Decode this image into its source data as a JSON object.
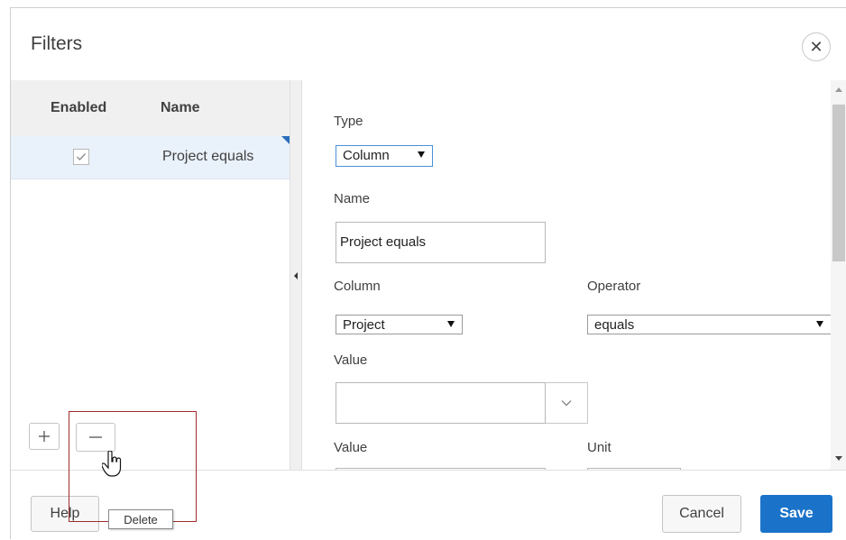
{
  "dialog": {
    "title": "Filters",
    "close_icon": "close-icon"
  },
  "list": {
    "headers": {
      "enabled": "Enabled",
      "name": "Name"
    },
    "rows": [
      {
        "enabled": true,
        "name": "Project equals"
      }
    ],
    "add_icon": "plus-icon",
    "remove_icon": "minus-icon"
  },
  "form": {
    "type_label": "Type",
    "type_value": "Column",
    "name_label": "Name",
    "name_value": "Project equals",
    "column_label": "Column",
    "column_value": "Project",
    "operator_label": "Operator",
    "operator_value": "equals",
    "value_label": "Value",
    "value_value": "",
    "value2_label": "Value",
    "unit_label": "Unit"
  },
  "footer": {
    "help_label": "Help",
    "cancel_label": "Cancel",
    "save_label": "Save"
  },
  "tooltip": {
    "text": "Delete"
  },
  "colors": {
    "accent": "#1b73c9",
    "selected_row": "#e9f1fa",
    "highlight": "#9c2d2d"
  }
}
